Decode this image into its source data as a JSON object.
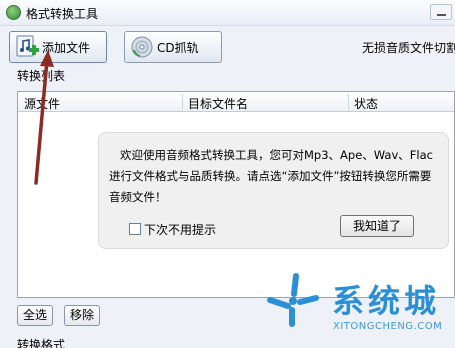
{
  "window": {
    "title": "格式转换工具"
  },
  "toolbar": {
    "add_file_label": "添加文件",
    "cd_rip_label": "CD抓轨",
    "lossless_text": "无损音质文件切割"
  },
  "file_list": {
    "section_label": "转换列表",
    "columns": [
      "源文件",
      "目标文件名",
      "状态"
    ]
  },
  "tip": {
    "message": "欢迎使用音频格式转换工具，您可对Mp3、Ape、Wav、Flac进行文件格式与品质转换。请点选“添加文件”按钮转换您所需要音频文件！",
    "dont_show_label": "下次不用提示",
    "dont_show_checked": false,
    "ok_label": "我知道了"
  },
  "list_actions": {
    "select_all_label": "全选",
    "remove_label": "移除"
  },
  "bottom": {
    "section_label": "转换格式"
  },
  "watermark": {
    "cn": "系统城",
    "en": "XITONGCHENG.COM"
  },
  "colors": {
    "watermark": "#2b8fd6",
    "arrow": "#8b2b22"
  },
  "icons": {
    "app": "app-icon",
    "add_file": "music-note-add-icon",
    "cd": "cd-disc-icon"
  }
}
